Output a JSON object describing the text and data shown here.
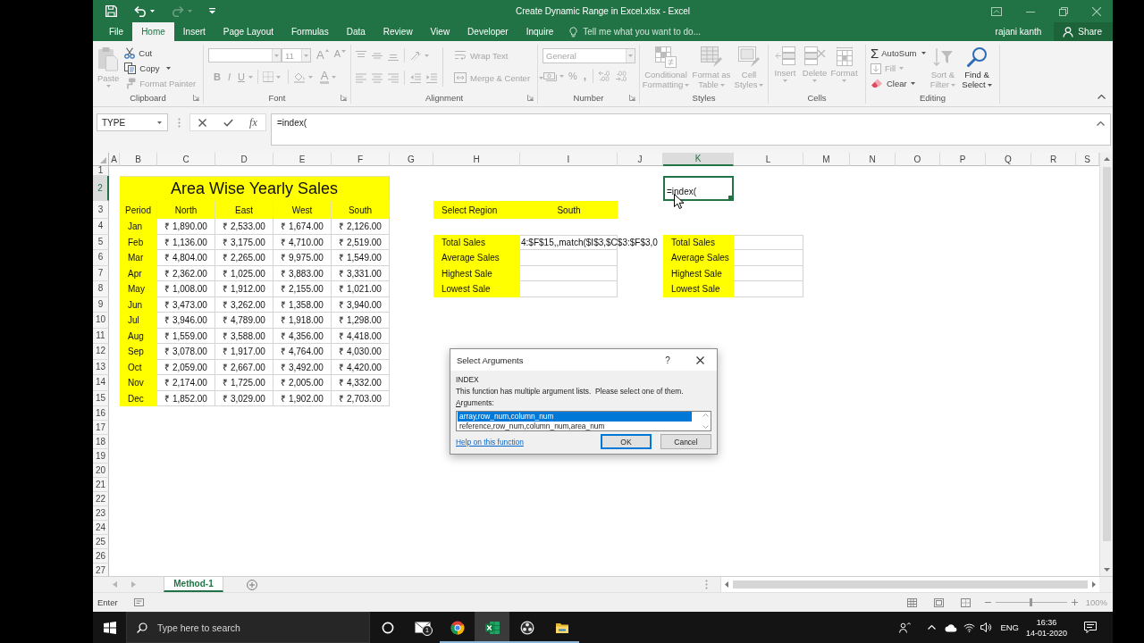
{
  "window": {
    "title": "Create Dynamic Range in Excel.xlsx - Excel"
  },
  "quick_access": [
    {
      "kind": "save",
      "disabled": false
    },
    {
      "kind": "undo",
      "disabled": false
    },
    {
      "kind": "redo",
      "disabled": true
    },
    {
      "kind": "customize",
      "disabled": false
    }
  ],
  "ribbon_tabs": [
    {
      "label": "File",
      "selected": false
    },
    {
      "label": "Home",
      "selected": true
    },
    {
      "label": "Insert",
      "selected": false
    },
    {
      "label": "Page Layout",
      "selected": false
    },
    {
      "label": "Formulas",
      "selected": false
    },
    {
      "label": "Data",
      "selected": false
    },
    {
      "label": "Review",
      "selected": false
    },
    {
      "label": "View",
      "selected": false
    },
    {
      "label": "Developer",
      "selected": false
    },
    {
      "label": "Inquire",
      "selected": false
    }
  ],
  "tell_me": {
    "placeholder": "Tell me what you want to do..."
  },
  "account": {
    "user": "rajani kanth",
    "share": "Share"
  },
  "ribbon_groups": [
    {
      "kind": "clipboard",
      "label": "Clipboard",
      "commands": [
        {
          "kind": "paste",
          "label": "Paste",
          "disabled": true
        },
        {
          "kind": "cut",
          "label": "Cut",
          "disabled": false
        },
        {
          "kind": "copy",
          "label": "Copy",
          "disabled": false
        },
        {
          "kind": "format_painter",
          "label": "Format Painter",
          "disabled": true
        }
      ]
    },
    {
      "kind": "font",
      "label": "Font",
      "disabled": true,
      "size": "11",
      "glyphs": {
        "grow": "A",
        "shrink": "A",
        "bold": "B",
        "italic": "I",
        "underline": "U",
        "font_letter": "A"
      }
    },
    {
      "kind": "alignment",
      "label": "Alignment",
      "disabled": true,
      "commands": [
        {
          "kind": "wrap_text",
          "label": "Wrap Text"
        },
        {
          "kind": "merge_center",
          "label": "Merge & Center"
        }
      ]
    },
    {
      "kind": "number",
      "label": "Number",
      "disabled": true,
      "format": "General",
      "glyphs": {
        "percent": "%",
        "comma": ","
      }
    },
    {
      "kind": "styles",
      "label": "Styles",
      "disabled": true,
      "commands": [
        {
          "kind": "conditional_formatting",
          "label": "Conditional Formatting"
        },
        {
          "kind": "format_as_table",
          "label": "Format as Table"
        },
        {
          "kind": "cell_styles",
          "label": "Cell Styles"
        }
      ]
    },
    {
      "kind": "cells",
      "label": "Cells",
      "disabled": true,
      "commands": [
        {
          "kind": "insert",
          "label": "Insert"
        },
        {
          "kind": "delete",
          "label": "Delete"
        },
        {
          "kind": "format",
          "label": "Format"
        }
      ]
    },
    {
      "kind": "editing",
      "label": "Editing",
      "commands": [
        {
          "kind": "autosum",
          "label": "AutoSum",
          "glyph": "Σ",
          "disabled": false
        },
        {
          "kind": "fill",
          "label": "Fill",
          "disabled": true
        },
        {
          "kind": "clear",
          "label": "Clear",
          "disabled": false
        },
        {
          "kind": "sort_filter",
          "label": "Sort & Filter",
          "disabled": true
        },
        {
          "kind": "find_select",
          "label": "Find & Select",
          "disabled": false
        }
      ]
    }
  ],
  "formula_bar": {
    "name_box": "TYPE",
    "function_glyph": "fx",
    "formula": "=index("
  },
  "columns": [
    {
      "label": "A",
      "selected": false
    },
    {
      "label": "B",
      "selected": false
    },
    {
      "label": "C",
      "selected": false
    },
    {
      "label": "D",
      "selected": false
    },
    {
      "label": "E",
      "selected": false
    },
    {
      "label": "F",
      "selected": false
    },
    {
      "label": "G",
      "selected": false
    },
    {
      "label": "H",
      "selected": false
    },
    {
      "label": "I",
      "selected": false
    },
    {
      "label": "J",
      "selected": false
    },
    {
      "label": "K",
      "selected": true
    },
    {
      "label": "L",
      "selected": false
    },
    {
      "label": "M",
      "selected": false
    },
    {
      "label": "N",
      "selected": false
    },
    {
      "label": "O",
      "selected": false
    },
    {
      "label": "P",
      "selected": false
    },
    {
      "label": "Q",
      "selected": false
    },
    {
      "label": "R",
      "selected": false
    },
    {
      "label": "S",
      "selected": false
    }
  ],
  "rows": [
    {
      "label": "1",
      "selected": false
    },
    {
      "label": "2",
      "selected": true
    },
    {
      "label": "3",
      "selected": false
    },
    {
      "label": "4",
      "selected": false
    },
    {
      "label": "5",
      "selected": false
    },
    {
      "label": "6",
      "selected": false
    },
    {
      "label": "7",
      "selected": false
    },
    {
      "label": "8",
      "selected": false
    },
    {
      "label": "9",
      "selected": false
    },
    {
      "label": "10",
      "selected": false
    },
    {
      "label": "11",
      "selected": false
    },
    {
      "label": "12",
      "selected": false
    },
    {
      "label": "13",
      "selected": false
    },
    {
      "label": "14",
      "selected": false
    },
    {
      "label": "15",
      "selected": false
    },
    {
      "label": "16",
      "selected": false
    },
    {
      "label": "17",
      "selected": false
    },
    {
      "label": "18",
      "selected": false
    },
    {
      "label": "19",
      "selected": false
    },
    {
      "label": "20",
      "selected": false
    },
    {
      "label": "21",
      "selected": false
    },
    {
      "label": "22",
      "selected": false
    },
    {
      "label": "23",
      "selected": false
    },
    {
      "label": "24",
      "selected": false
    },
    {
      "label": "25",
      "selected": false
    },
    {
      "label": "26",
      "selected": false
    },
    {
      "label": "27",
      "selected": false
    }
  ],
  "sales_table": {
    "title": "Area Wise Yearly Sales",
    "columns": [
      "Period",
      "North",
      "East",
      "West",
      "South"
    ],
    "rows": [
      [
        "Jan",
        "₹ 1,890.00",
        "₹ 2,533.00",
        "₹ 1,674.00",
        "₹ 2,126.00"
      ],
      [
        "Feb",
        "₹ 1,136.00",
        "₹ 3,175.00",
        "₹ 4,710.00",
        "₹ 2,519.00"
      ],
      [
        "Mar",
        "₹ 4,804.00",
        "₹ 2,265.00",
        "₹ 9,975.00",
        "₹ 1,549.00"
      ],
      [
        "Apr",
        "₹ 2,362.00",
        "₹ 1,025.00",
        "₹ 3,883.00",
        "₹ 3,331.00"
      ],
      [
        "May",
        "₹ 1,008.00",
        "₹ 1,912.00",
        "₹ 2,155.00",
        "₹ 1,021.00"
      ],
      [
        "Jun",
        "₹ 3,473.00",
        "₹ 3,262.00",
        "₹ 1,358.00",
        "₹ 3,940.00"
      ],
      [
        "Jul",
        "₹ 3,946.00",
        "₹ 4,789.00",
        "₹ 1,918.00",
        "₹ 1,298.00"
      ],
      [
        "Aug",
        "₹ 1,559.00",
        "₹ 3,588.00",
        "₹ 4,356.00",
        "₹ 4,418.00"
      ],
      [
        "Sep",
        "₹ 3,078.00",
        "₹ 1,917.00",
        "₹ 4,764.00",
        "₹ 4,030.00"
      ],
      [
        "Oct",
        "₹ 2,059.00",
        "₹ 2,667.00",
        "₹ 3,492.00",
        "₹ 4,420.00"
      ],
      [
        "Nov",
        "₹ 2,174.00",
        "₹ 1,725.00",
        "₹ 2,005.00",
        "₹ 4,332.00"
      ],
      [
        "Dec",
        "₹ 1,852.00",
        "₹ 3,029.00",
        "₹ 1,902.00",
        "₹ 2,703.00"
      ]
    ]
  },
  "region_selector": {
    "label": "Select Region",
    "value": "South"
  },
  "summary_left": [
    {
      "label": "Total Sales",
      "value": "4:$F$15,,match($I$3,$C$3:$F$3,0"
    },
    {
      "label": "Average Sales"
    },
    {
      "label": "Highest Sale"
    },
    {
      "label": "Lowest Sale"
    }
  ],
  "summary_right": [
    {
      "label": "Total Sales"
    },
    {
      "label": "Average Sales"
    },
    {
      "label": "Highest Sale"
    },
    {
      "label": "Lowest Sale"
    }
  ],
  "active_cell": {
    "value": "=index("
  },
  "dialog": {
    "title": "Select Arguments",
    "help_button": "?",
    "function_name": "INDEX",
    "description": "This function has multiple argument lists.  Please select one of them.",
    "arguments_label": "Arguments:",
    "arguments": [
      {
        "label": "array,row_num,column_num",
        "selected": true
      },
      {
        "label": "reference,row_num,column_num,area_num",
        "selected": false
      }
    ],
    "help_link": "Help on this function",
    "buttons": [
      {
        "label": "OK",
        "default": true
      },
      {
        "label": "Cancel",
        "default": false
      }
    ]
  },
  "sheet_tabs": [
    {
      "label": "Method-1",
      "selected": true
    }
  ],
  "status_bar": {
    "mode": "Enter",
    "zoom": "100%",
    "zoom_slider": {
      "level": 0.5
    }
  },
  "taskbar": {
    "search": {
      "placeholder": "Type here to search"
    },
    "apps": [
      {
        "kind": "cortana",
        "running": false,
        "selected": false
      },
      {
        "kind": "mail",
        "badge": "1",
        "running": false,
        "selected": false
      },
      {
        "kind": "chrome",
        "running": true,
        "selected": false
      },
      {
        "kind": "excel",
        "running": true,
        "selected": true
      },
      {
        "kind": "obs",
        "running": true,
        "selected": false
      },
      {
        "kind": "explorer",
        "running": true,
        "selected": false
      }
    ],
    "language": "ENG",
    "time": "16:36",
    "date": "14-01-2020"
  }
}
